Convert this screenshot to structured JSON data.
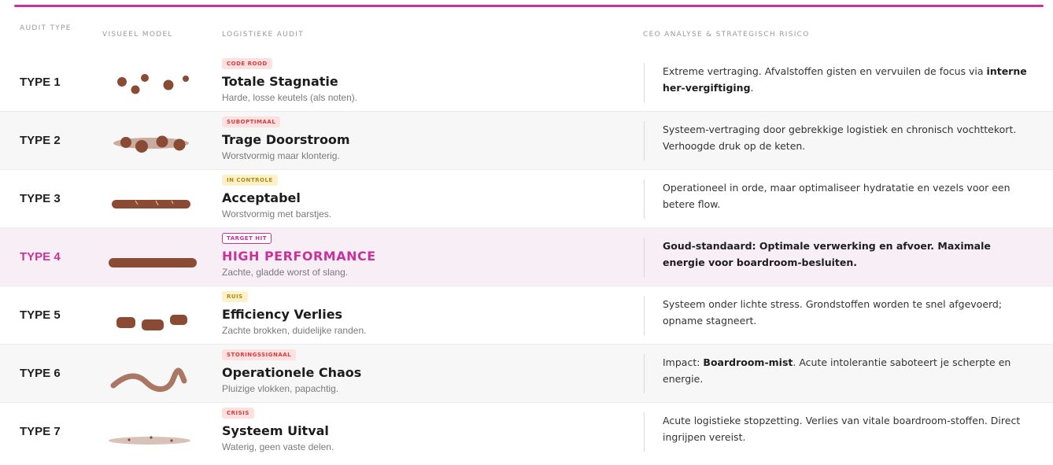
{
  "headers": {
    "audit_type": "AUDIT TYPE",
    "visual_model": "VISUEEL MODEL",
    "logistic_audit": "LOGISTIEKE AUDIT",
    "ceo_analysis": "CEO ANALYSE & STRATEGISCH RISICO"
  },
  "colors": {
    "accent": "#c8329a",
    "stool_brown": "#8b4a33",
    "badge_red_bg": "#fde0e0",
    "badge_yellow_bg": "#fdf1c9"
  },
  "rows": [
    {
      "type": "TYPE 1",
      "badge": "CODE ROOD",
      "title": "Totale Stagnatie",
      "subtitle": "Harde, losse keutels (als noten).",
      "analysis_pre": "Extreme vertraging. Afvalstoffen gisten en vervuilen de focus via ",
      "analysis_bold": "interne her-vergiftiging",
      "analysis_post": "."
    },
    {
      "type": "TYPE 2",
      "badge": "SUBOPTIMAAL",
      "title": "Trage Doorstroom",
      "subtitle": "Worstvormig maar klonterig.",
      "analysis_pre": "Systeem-vertraging door gebrekkige logistiek en chronisch vochttekort. Verhoogde druk op de keten.",
      "analysis_bold": "",
      "analysis_post": ""
    },
    {
      "type": "TYPE 3",
      "badge": "IN CONTROLE",
      "title": "Acceptabel",
      "subtitle": "Worstvormig met barstjes.",
      "analysis_pre": "Operationeel in orde, maar optimaliseer hydratatie en vezels voor een betere flow.",
      "analysis_bold": "",
      "analysis_post": ""
    },
    {
      "type": "TYPE 4",
      "badge": "TARGET HIT",
      "title": "HIGH PERFORMANCE",
      "subtitle": "Zachte, gladde worst of slang.",
      "analysis_pre": "Goud-standaard: Optimale verwerking en afvoer. Maximale energie voor boardroom-besluiten.",
      "analysis_bold": "",
      "analysis_post": ""
    },
    {
      "type": "TYPE 5",
      "badge": "RUIS",
      "title": "Efficiency Verlies",
      "subtitle": "Zachte brokken, duidelijke randen.",
      "analysis_pre": "Systeem onder lichte stress. Grondstoffen worden te snel afgevoerd; opname stagneert.",
      "analysis_bold": "",
      "analysis_post": ""
    },
    {
      "type": "TYPE 6",
      "badge": "STORINGSSIGNAAL",
      "title": "Operationele Chaos",
      "subtitle": "Pluizige vlokken, papachtig.",
      "analysis_pre": "Impact: ",
      "analysis_bold": "Boardroom-mist",
      "analysis_post": ". Acute intolerantie saboteert je scherpte en energie."
    },
    {
      "type": "TYPE 7",
      "badge": "CRISIS",
      "title": "Systeem Uitval",
      "subtitle": "Waterig, geen vaste delen.",
      "analysis_pre": "Acute logistieke stopzetting. Verlies van vitale boardroom-stoffen. Direct ingrijpen vereist.",
      "analysis_bold": "",
      "analysis_post": ""
    }
  ]
}
